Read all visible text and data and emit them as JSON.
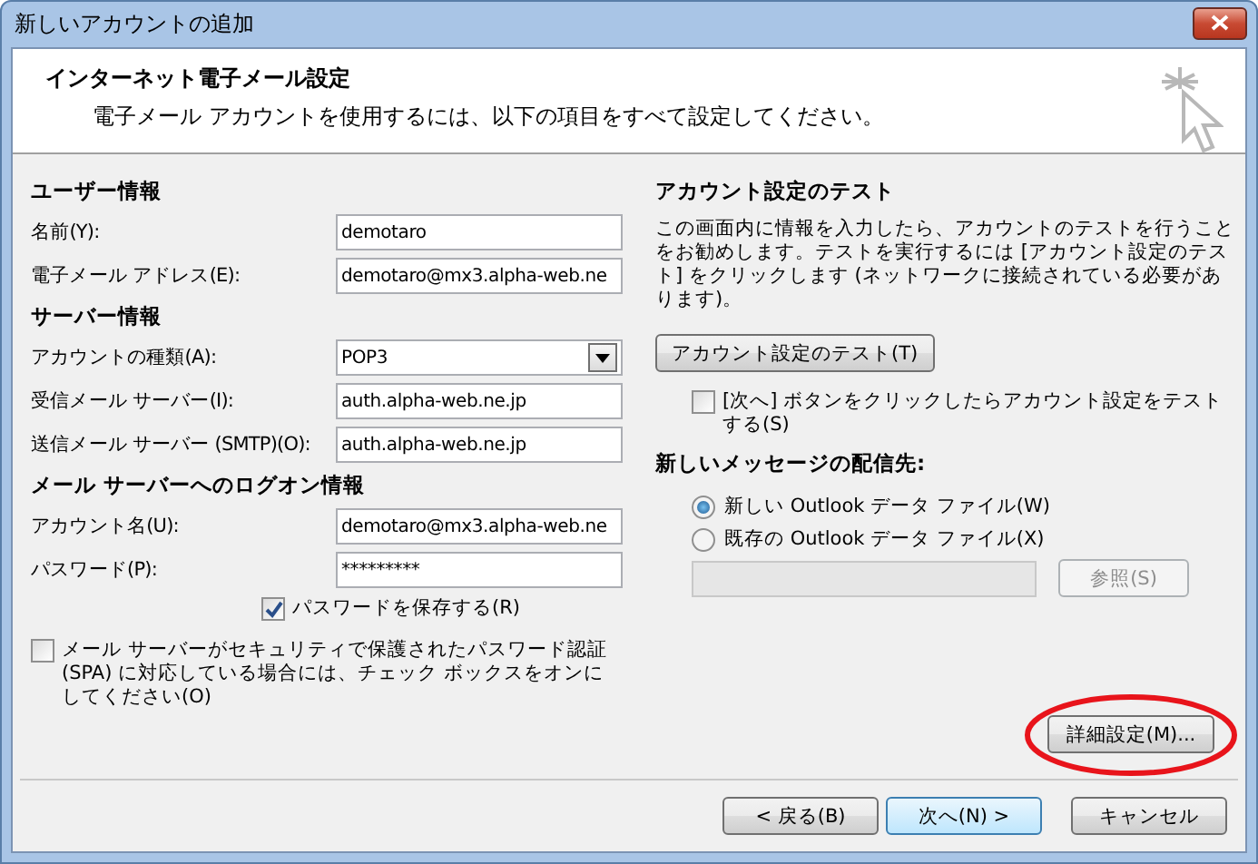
{
  "window": {
    "title": "新しいアカウントの追加"
  },
  "header": {
    "title": "インターネット電子メール設定",
    "subtitle": "電子メール アカウントを使用するには、以下の項目をすべて設定してください。"
  },
  "left_sections": [
    {
      "heading": "ユーザー情報",
      "fields": [
        {
          "kind": "text",
          "label": "名前(Y):",
          "value": "demotaro"
        },
        {
          "kind": "text",
          "label": "電子メール アドレス(E):",
          "value": "demotaro@mx3.alpha-web.ne"
        }
      ]
    },
    {
      "heading": "サーバー情報",
      "fields": [
        {
          "kind": "select",
          "label": "アカウントの種類(A):",
          "value": "POP3"
        },
        {
          "kind": "text",
          "label": "受信メール サーバー(I):",
          "value": "auth.alpha-web.ne.jp"
        },
        {
          "kind": "text",
          "label": "送信メール サーバー (SMTP)(O):",
          "value": "auth.alpha-web.ne.jp"
        }
      ]
    },
    {
      "heading": "メール サーバーへのログオン情報",
      "fields": [
        {
          "kind": "text",
          "label": "アカウント名(U):",
          "value": "demotaro@mx3.alpha-web.ne"
        },
        {
          "kind": "text",
          "label": "パスワード(P):",
          "value": "*********"
        }
      ]
    }
  ],
  "save_password": {
    "label": "パスワードを保存する(R)",
    "checked": true
  },
  "spa": {
    "label": "メール サーバーがセキュリティで保護されたパスワード認証 (SPA) に対応している場合には、チェック ボックスをオンにしてください(O)",
    "checked": false
  },
  "test": {
    "heading": "アカウント設定のテスト",
    "description": "この画面内に情報を入力したら、アカウントのテストを行うことをお勧めします。テストを実行するには [アカウント設定のテスト] をクリックします (ネットワークに接続されている必要があります)。",
    "button": "アカウント設定のテスト(T)",
    "auto_test": {
      "label": "[次へ] ボタンをクリックしたらアカウント設定をテストする(S)",
      "checked": false
    }
  },
  "delivery": {
    "heading": "新しいメッセージの配信先:",
    "options": [
      {
        "label": "新しい Outlook データ ファイル(W)",
        "selected": true
      },
      {
        "label": "既存の Outlook データ ファイル(X)",
        "selected": false
      }
    ],
    "path_field": {
      "disabled": true
    },
    "browse_button": {
      "label": "参照(S)",
      "disabled": true
    }
  },
  "advanced_button": {
    "label": "詳細設定(M)...",
    "highlighted": true
  },
  "footer_buttons": [
    {
      "label": "< 戻る(B)",
      "default": false
    },
    {
      "label": "次へ(N) >",
      "default": true
    },
    {
      "label": "キャンセル",
      "default": false
    }
  ]
}
